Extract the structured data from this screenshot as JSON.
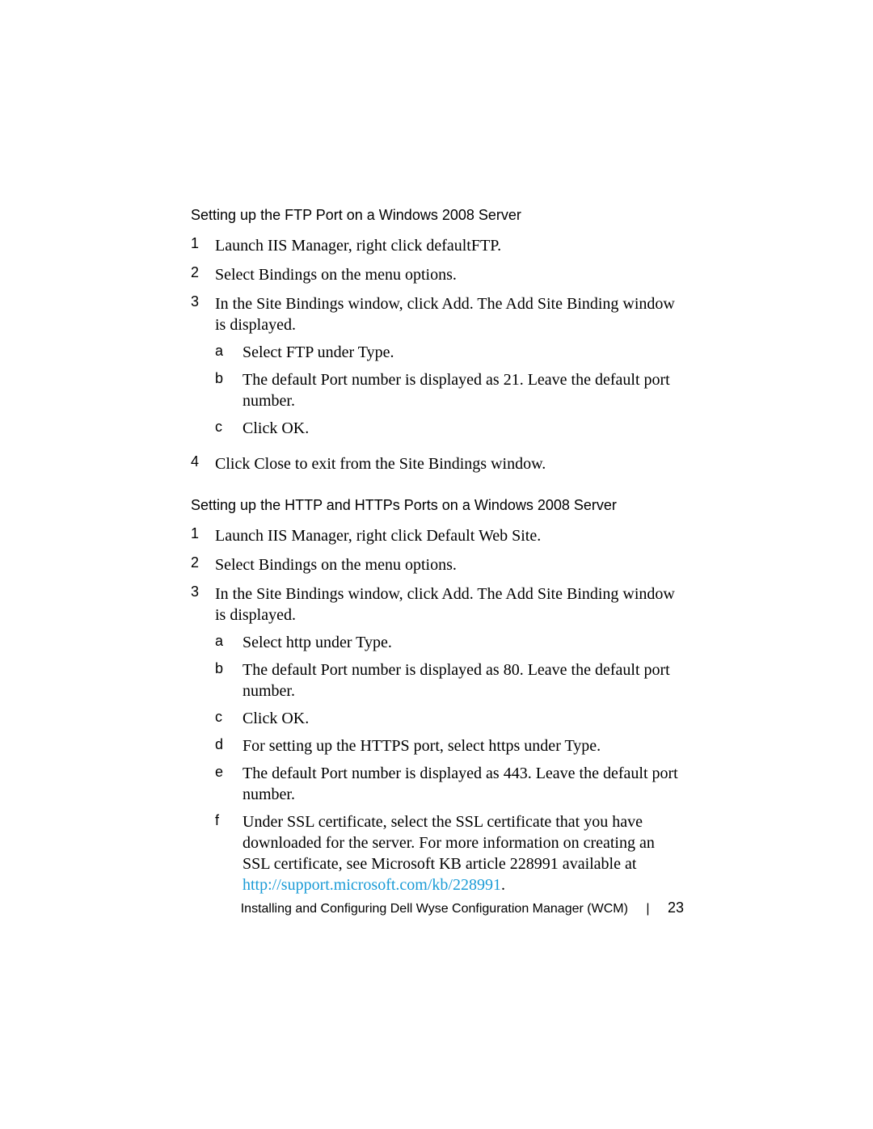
{
  "section1": {
    "heading": "Setting up the FTP Port on a Windows 2008 Server",
    "items": [
      {
        "n": "1",
        "text": "Launch IIS Manager, right click defaultFTP."
      },
      {
        "n": "2",
        "text": "Select Bindings on the menu options."
      },
      {
        "n": "3",
        "text": "In the Site Bindings window, click Add. The Add Site Binding window is displayed.",
        "sub": [
          {
            "m": "a",
            "text": "Select FTP under Type."
          },
          {
            "m": "b",
            "text": "The default Port number is displayed as 21. Leave the default port number."
          },
          {
            "m": "c",
            "text": "Click OK."
          }
        ]
      },
      {
        "n": "4",
        "text": "Click Close to exit from the Site Bindings window."
      }
    ]
  },
  "section2": {
    "heading": "Setting up the HTTP and HTTPs Ports on a Windows 2008 Server",
    "items": [
      {
        "n": "1",
        "text": "Launch IIS Manager, right click Default Web Site."
      },
      {
        "n": "2",
        "text": "Select Bindings on the menu options."
      },
      {
        "n": "3",
        "text": "In the Site Bindings window, click Add. The Add Site Binding window is displayed.",
        "sub": [
          {
            "m": "a",
            "text": "Select http under Type."
          },
          {
            "m": "b",
            "text": "The default Port number is displayed as 80. Leave the default port number."
          },
          {
            "m": "c",
            "text": "Click OK."
          },
          {
            "m": "d",
            "text": "For setting up the HTTPS port, select https under Type."
          },
          {
            "m": "e",
            "text": "The default Port number is displayed as 443. Leave the default port number."
          },
          {
            "m": "f",
            "text_pre": "Under SSL certificate, select the SSL certificate that you have downloaded for the server. For more information on creating an SSL certificate, see Microsoft KB article 228991 available at ",
            "link_text": "http://support.microsoft.com/kb/228991",
            "text_post": "."
          }
        ]
      }
    ]
  },
  "footer": {
    "title": "Installing and Configuring Dell Wyse Configuration Manager (WCM)",
    "page": "23"
  }
}
